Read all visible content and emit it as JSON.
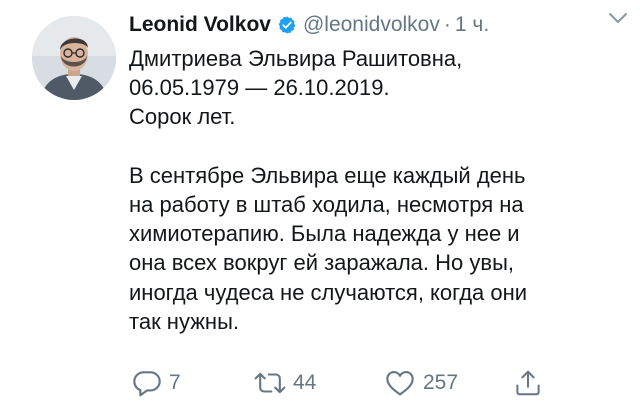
{
  "tweet": {
    "author_name": "Leonid Volkov",
    "handle": "@leonidvolkov",
    "separator": "·",
    "time": "1 ч.",
    "text_lines": [
      "Дмитриева Эльвира Рашитовна,",
      "06.05.1979 — 26.10.2019.",
      "Сорок лет.",
      "",
      "В сентябре Эльвира еще каждый день",
      "на работу в штаб ходила, несмотря на",
      "химиотерапию. Была надежда у нее и",
      "она всех вокруг ей заражала. Но увы,",
      "иногда чудеса не случаются, когда они",
      "так нужны."
    ]
  },
  "actions": {
    "replies": "7",
    "retweets": "44",
    "likes": "257"
  },
  "icons": {
    "verified": "verified-badge-icon",
    "caret": "chevron-down-icon",
    "reply": "reply-icon",
    "retweet": "retweet-icon",
    "like": "heart-icon",
    "share": "share-icon"
  },
  "colors": {
    "text": "#14171a",
    "secondary": "#657786",
    "verified": "#1da1f2"
  }
}
